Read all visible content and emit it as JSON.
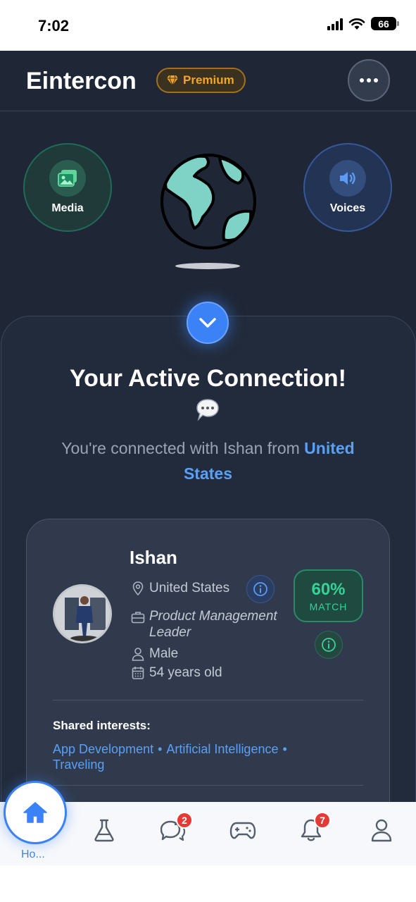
{
  "status_bar": {
    "time": "7:02",
    "battery": "66"
  },
  "header": {
    "title": "Eintercon",
    "premium_label": "Premium"
  },
  "quick_actions": {
    "media_label": "Media",
    "voices_label": "Voices"
  },
  "connection": {
    "title": "Your Active Connection!",
    "subtitle_prefix": "You're connected with Ishan from ",
    "country": "United States"
  },
  "profile": {
    "name": "Ishan",
    "location": "United States",
    "occupation": "Product Management Leader",
    "gender": "Male",
    "age": "54 years old",
    "match_percent": "60%",
    "match_label": "MATCH"
  },
  "shared_interests": {
    "title": "Shared interests:",
    "items": [
      "App Development",
      "Artificial Intelligence",
      "Traveling"
    ]
  },
  "nav": {
    "home_label": "Ho...",
    "messages_badge": "2",
    "notifications_badge": "7"
  },
  "colors": {
    "accent": "#3b82f6",
    "match": "#34d399",
    "premium": "#f5a524",
    "background": "#1f2736"
  }
}
